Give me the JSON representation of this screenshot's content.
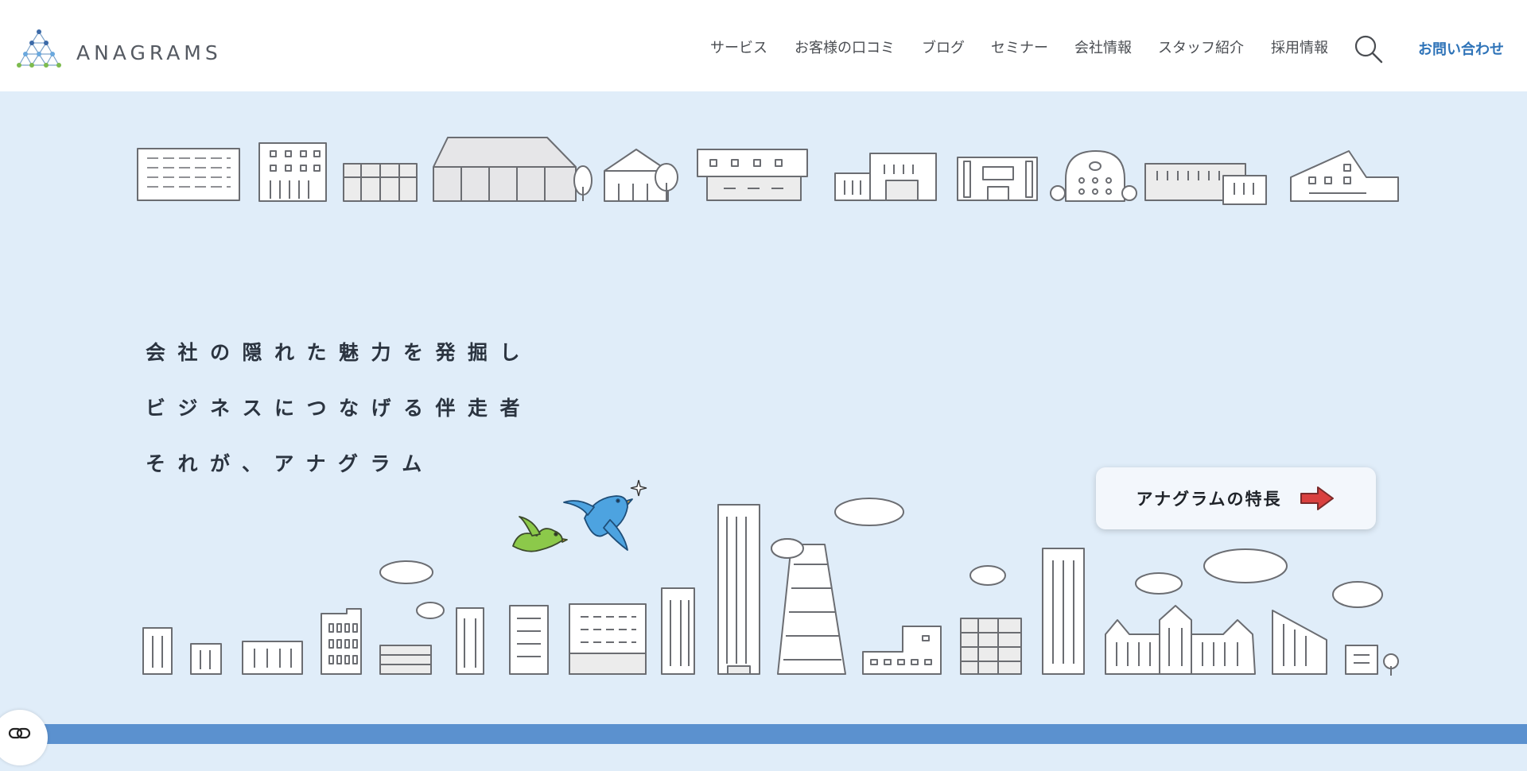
{
  "brand": {
    "name": "ANAGRAMS"
  },
  "nav": {
    "items": [
      {
        "label": "サービス"
      },
      {
        "label": "お客様の口コミ"
      },
      {
        "label": "ブログ"
      },
      {
        "label": "セミナー"
      },
      {
        "label": "会社情報"
      },
      {
        "label": "スタッフ紹介"
      },
      {
        "label": "採用情報"
      }
    ],
    "search_icon": "search-icon",
    "contact_label": "お問い合わせ",
    "contact_color": "#2e73b8"
  },
  "hero": {
    "tagline": [
      "会社の隠れた魅力を発掘し",
      "ビジネスにつなげる伴走者",
      "それが、アナグラム"
    ],
    "feature_button_label": "アナグラムの特長",
    "feature_button_icon": "arrow-right-icon",
    "background": "#e0edf9"
  },
  "colors": {
    "bottom_bar": "#5b91cf",
    "bird_blue": "#4da3e0",
    "bird_green": "#8cc94a",
    "arrow_red": "#d9403f"
  }
}
